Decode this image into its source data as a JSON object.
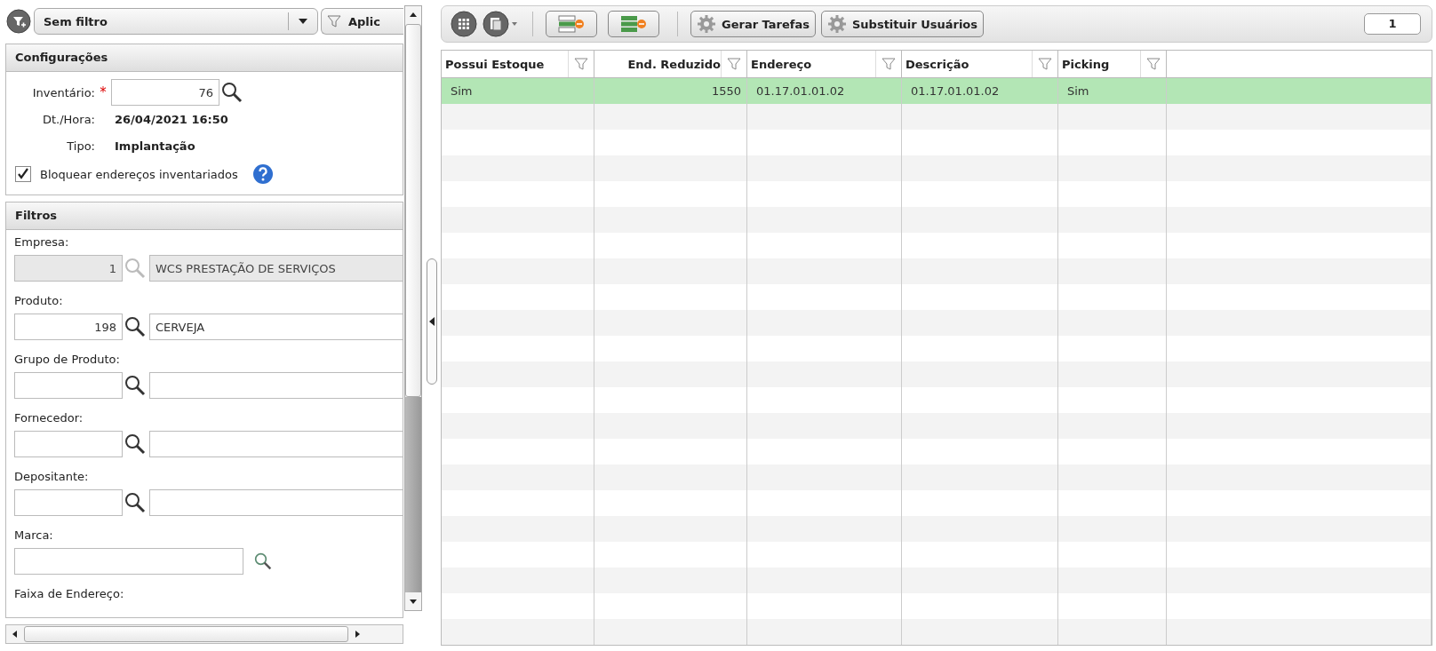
{
  "filter_bar": {
    "select": "Sem filtro",
    "apply_button": "Aplic"
  },
  "config": {
    "title": "Configurações",
    "inventory": {
      "label": "Inventário:",
      "required_mark": "*",
      "value": "76"
    },
    "date": {
      "label": "Dt./Hora:",
      "value": "26/04/2021 16:50"
    },
    "type": {
      "label": "Tipo:",
      "value": "Implantação"
    },
    "block_checkbox": {
      "label": "Bloquear endereços inventariados",
      "checked": true
    }
  },
  "filters": {
    "title": "Filtros",
    "fields": [
      {
        "kind": "lookup",
        "label": "Empresa:",
        "code": "1",
        "description": "WCS PRESTAÇÃO DE SERVIÇOS",
        "disabled": true
      },
      {
        "kind": "lookup",
        "label": "Produto:",
        "code": "198",
        "description": "CERVEJA",
        "disabled": false
      },
      {
        "kind": "lookup",
        "label": "Grupo de Produto:",
        "disabled": false
      },
      {
        "kind": "lookup",
        "label": "Fornecedor:",
        "disabled": false
      },
      {
        "kind": "lookup",
        "label": "Depositante:",
        "disabled": false
      },
      {
        "kind": "single",
        "label": "Marca:",
        "disabled": false
      },
      {
        "kind": "heading",
        "label": "Faixa de Endereço:"
      }
    ]
  },
  "toolbar": {
    "buttons": [
      "Gerar Tarefas",
      "Substituir Usuários"
    ],
    "count": "1"
  },
  "table": {
    "columns": [
      {
        "label": "Possui Estoque",
        "kind": "text"
      },
      {
        "label": "End. Reduzido",
        "kind": "number"
      },
      {
        "label": "Endereço",
        "kind": "text"
      },
      {
        "label": "Descrição",
        "kind": "text"
      },
      {
        "label": "Picking",
        "kind": "text"
      }
    ],
    "rows": [
      {
        "selected": true,
        "cells": [
          "Sim",
          "1550",
          "01.17.01.01.02",
          "01.17.01.01.02",
          "Sim"
        ]
      }
    ]
  }
}
